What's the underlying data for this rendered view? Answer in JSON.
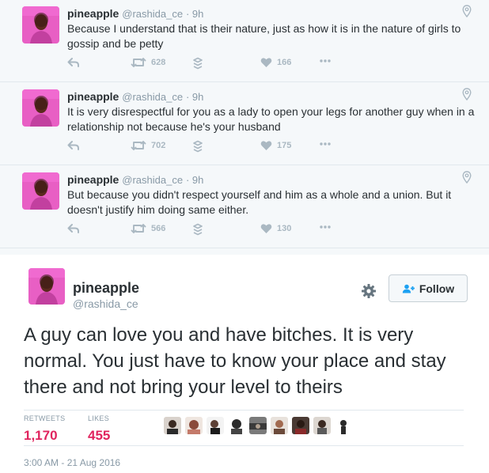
{
  "replies": [
    {
      "name": "pineapple",
      "handle": "@rashida_ce",
      "time": "· 9h",
      "text": "Because I understand that is their nature,  just as how it is in the nature of girls to gossip and be petty",
      "retweets": "628",
      "likes": "166"
    },
    {
      "name": "pineapple",
      "handle": "@rashida_ce",
      "time": "· 9h",
      "text": "It is very disrespectful for you as a lady to open your legs for another guy when in a relationship not because he's your husband",
      "retweets": "702",
      "likes": "175"
    },
    {
      "name": "pineapple",
      "handle": "@rashida_ce",
      "time": "· 9h",
      "text": "But because you didn't respect yourself and him as a whole and a union.  But it doesn't justify him doing same either.",
      "retweets": "566",
      "likes": "130"
    }
  ],
  "main": {
    "name": "pineapple",
    "handle": "@rashida_ce",
    "follow_label": "Follow",
    "text": "A guy can love you and have bitches. It is very normal.  You just have to know your place and stay there and not bring your level to theirs",
    "retweets_label": "RETWEETS",
    "retweets": "1,170",
    "likes_label": "LIKES",
    "likes": "455",
    "timestamp": "3:00 AM - 21 Aug 2016"
  },
  "icons": {
    "reply": "reply-icon",
    "retweet": "retweet-icon",
    "add_to_moment": "moment-icon",
    "like": "heart-icon",
    "more": "more-icon",
    "location": "location-pin-icon",
    "settings": "gear-icon",
    "follow": "add-user-icon"
  },
  "colors": {
    "accent_like": "#e0245e",
    "follow_icon": "#1da1f2",
    "muted": "#8899a6",
    "avatar_pink": "#e85fc4"
  }
}
